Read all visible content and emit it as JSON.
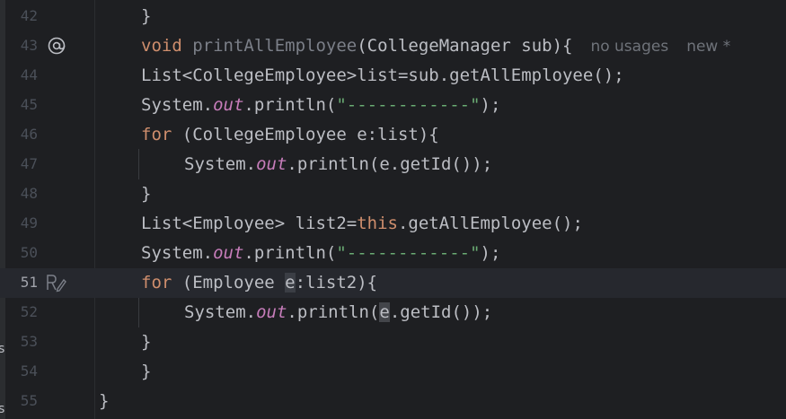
{
  "editor": {
    "left_edge_chars": [
      "s",
      "s"
    ],
    "lines": [
      {
        "num": "42",
        "tokens": [
          {
            "t": "}",
            "c": "plain"
          }
        ],
        "indent": 1
      },
      {
        "num": "43",
        "icon": "at-icon",
        "indent": 1,
        "tokens": [
          {
            "t": "void ",
            "c": "kw"
          },
          {
            "t": "printAllEmployee",
            "c": "fn-unused"
          },
          {
            "t": "(CollegeManager sub){",
            "c": "plain"
          }
        ],
        "hints": [
          "no usages",
          "new *"
        ]
      },
      {
        "num": "44",
        "indent": 1,
        "tokens": [
          {
            "t": "List<CollegeEmployee>list=sub.getAllEmployee();",
            "c": "plain"
          }
        ]
      },
      {
        "num": "45",
        "indent": 1,
        "tokens": [
          {
            "t": "System.",
            "c": "plain"
          },
          {
            "t": "out",
            "c": "field"
          },
          {
            "t": ".println(",
            "c": "plain"
          },
          {
            "t": "\"------------\"",
            "c": "str"
          },
          {
            "t": ");",
            "c": "plain"
          }
        ]
      },
      {
        "num": "46",
        "indent": 1,
        "tokens": [
          {
            "t": "for ",
            "c": "kw"
          },
          {
            "t": "(CollegeEmployee e:list){",
            "c": "plain"
          }
        ]
      },
      {
        "num": "47",
        "indent": 2,
        "tokens": [
          {
            "t": "System.",
            "c": "plain"
          },
          {
            "t": "out",
            "c": "field"
          },
          {
            "t": ".println(e.getId());",
            "c": "plain"
          }
        ]
      },
      {
        "num": "48",
        "indent": 1,
        "tokens": [
          {
            "t": "}",
            "c": "plain"
          }
        ]
      },
      {
        "num": "49",
        "indent": 1,
        "tokens": [
          {
            "t": "List<Employee> list2=",
            "c": "plain"
          },
          {
            "t": "this",
            "c": "kw"
          },
          {
            "t": ".getAllEmployee();",
            "c": "plain"
          }
        ]
      },
      {
        "num": "50",
        "indent": 1,
        "tokens": [
          {
            "t": "System.",
            "c": "plain"
          },
          {
            "t": "out",
            "c": "field"
          },
          {
            "t": ".println(",
            "c": "plain"
          },
          {
            "t": "\"------------\"",
            "c": "str"
          },
          {
            "t": ");",
            "c": "plain"
          }
        ]
      },
      {
        "num": "51",
        "icon": "reader-mode-icon",
        "current": true,
        "indent": 1,
        "tokens": [
          {
            "t": "for ",
            "c": "kw"
          },
          {
            "t": "(Employee ",
            "c": "plain"
          },
          {
            "t": "e",
            "c": "plain hl-e"
          },
          {
            "t": ":list2){",
            "c": "plain"
          }
        ]
      },
      {
        "num": "52",
        "indent": 2,
        "tokens": [
          {
            "t": "System.",
            "c": "plain"
          },
          {
            "t": "out",
            "c": "field"
          },
          {
            "t": ".println(",
            "c": "plain"
          },
          {
            "t": "e",
            "c": "plain hl-e2"
          },
          {
            "t": ".getId());",
            "c": "plain"
          }
        ]
      },
      {
        "num": "53",
        "indent": 1,
        "tokens": [
          {
            "t": "}",
            "c": "plain"
          }
        ]
      },
      {
        "num": "54",
        "indent": 1,
        "tokens": [
          {
            "t": "}",
            "c": "plain"
          }
        ]
      },
      {
        "num": "55",
        "indent": 0,
        "tokens": [
          {
            "t": "}",
            "c": "plain"
          }
        ]
      }
    ]
  }
}
